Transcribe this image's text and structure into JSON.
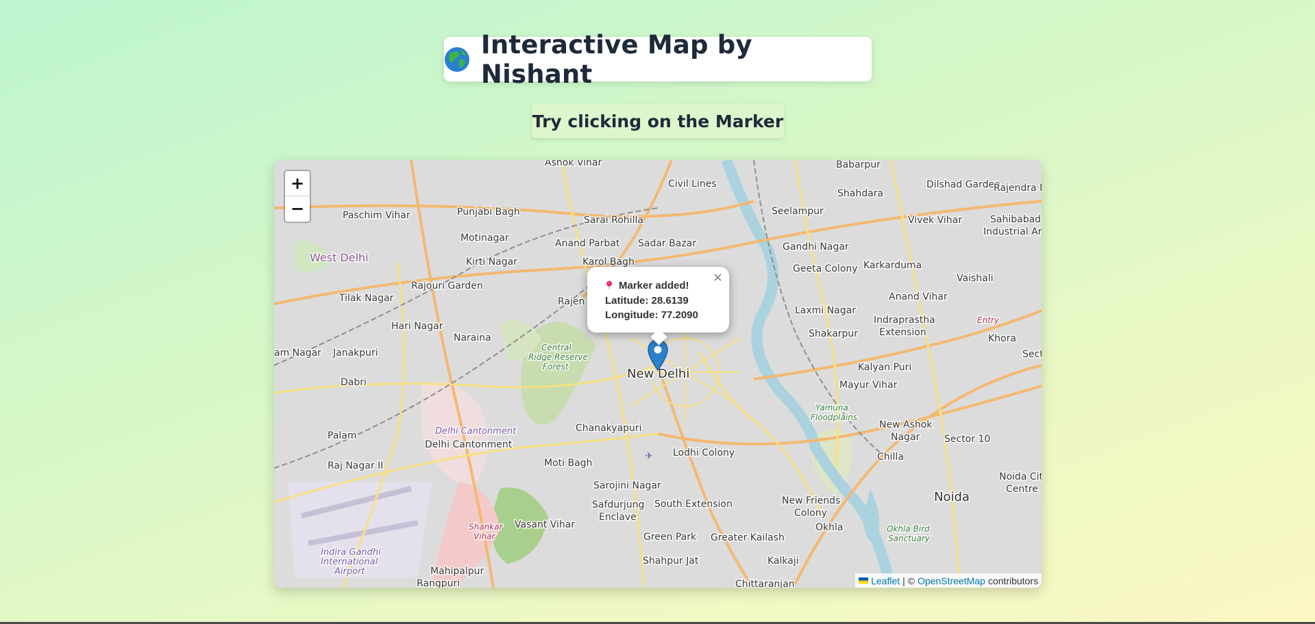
{
  "header": {
    "title": "Interactive Map by Nishant",
    "globe_icon": "globe-asia-icon"
  },
  "subtitle": "Try clicking on the Marker",
  "map": {
    "zoom_in_label": "+",
    "zoom_out_label": "−",
    "popup": {
      "icon": "round-pushpin-icon",
      "title": "Marker added!",
      "latitude_label": "Latitude: 28.6139",
      "longitude_label": "Longitude: 77.2090",
      "close_label": "×"
    },
    "marker": {
      "lat": 28.6139,
      "lng": 77.209,
      "color": "#2a81cb"
    },
    "labels": {
      "ashok_vihar": "Ashok Vihar",
      "babarpur": "Babarpur",
      "dilshad_garden": "Dilshad Garden",
      "rajendra_n": "Rajendra N",
      "civil_lines": "Civil Lines",
      "shahdara": "Shahdara",
      "punjabi_bagh": "Punjabi Bagh",
      "paschim_vihar": "Paschim Vihar",
      "sarai_rohilla": "Sarai Rohilla",
      "seelampur": "Seelampur",
      "vivek_vihar": "Vivek Vihar",
      "sahibabad": "Sahibabad",
      "industrial_area": "Industrial Area",
      "motinagar": "Motinagar",
      "anand_parbat": "Anand Parbat",
      "sadar_bazar": "Sadar Bazar",
      "gandhi_nagar": "Gandhi Nagar",
      "west_delhi": "West Delhi",
      "kirti_nagar": "Kirti Nagar",
      "karol_bagh": "Karol Bagh",
      "geeta_colony": "Geeta Colony",
      "karkarduma": "Karkarduma",
      "vaishali": "Vaishali",
      "rajouri_garden": "Rajouri Garden",
      "tilak_nagar": "Tilak Nagar",
      "rajen": "Rajen",
      "anand_vihar": "Anand Vihar",
      "laxmi_nagar": "Laxmi Nagar",
      "hari_nagar": "Hari Nagar",
      "indraprastha": "Indraprastha",
      "extension": "Extension",
      "entry": "Entry",
      "naraina": "Naraina",
      "shakarpur": "Shakarpur",
      "khora": "Khora",
      "am_nagar": "am Nagar",
      "janakpuri": "Janakpuri",
      "central": "Central",
      "ridge_reserve": "Ridge Reserve",
      "forest": "Forest",
      "kalyan_puri": "Kalyan Puri",
      "sect": "Sect",
      "new_delhi": "New Delhi",
      "dabri": "Dabri",
      "mayur_vihar": "Mayur Vihar",
      "yamuna": "Yamuna",
      "floodplains": "Floodplains",
      "chanakyapuri": "Chanakyapuri",
      "delhi_cantonment_it": "Delhi Cantonment",
      "delhi_cantonment": "Delhi Cantonment",
      "new_ashok": "New Ashok",
      "nagar": "Nagar",
      "palam": "Palam",
      "sector_10": "Sector 10",
      "lodhi_colony": "Lodhi Colony",
      "chilla": "Chilla",
      "raj_nagar_ii": "Raj Nagar II",
      "moti_bagh": "Moti Bagh",
      "noida_city": "Noida City",
      "centre": "Centre",
      "sarojini_nagar": "Sarojini Nagar",
      "noida": "Noida",
      "safdurjung": "Safdurjung",
      "enclave": "Enclave",
      "south_extension": "South Extension",
      "new_friends": "New Friends",
      "colony": "Colony",
      "shankar": "Shankar",
      "vihar": "Vihar",
      "vasant_vihar": "Vasant Vihar",
      "okhla": "Okhla",
      "okhla_bird": "Okhla Bird",
      "sanctuary": "Sanctuary",
      "indira_gandhi": "Indira Gandhi",
      "international": "International",
      "airport": "Airport",
      "green_park": "Green Park",
      "greater_kailash": "Greater Kailash",
      "kalkaji": "Kalkaji",
      "shahpur_jat": "Shahpur Jat",
      "mahipalpur": "Mahipalpur",
      "rangpuri": "Rangpuri",
      "chittaranjan": "Chittaranjan"
    }
  },
  "attribution": {
    "leaflet": "Leaflet",
    "separator": "| ©",
    "osm": "OpenStreetMap",
    "suffix": "contributors"
  }
}
